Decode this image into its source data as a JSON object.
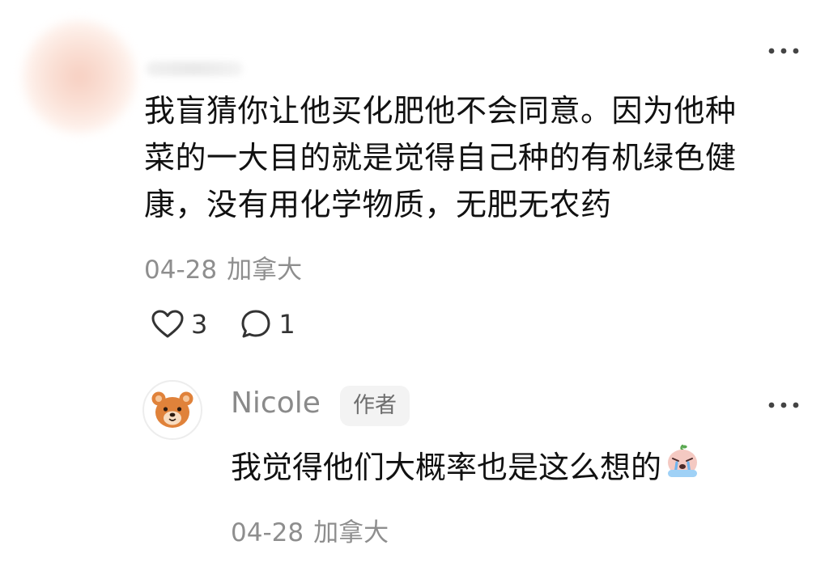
{
  "comment": {
    "body_lines": [
      "我盲猜你让他买化肥他不会同意。因为他种",
      "菜的一大目的就是觉得自己种的有机绿色健",
      "康，没有用化学物质，无肥无农药"
    ],
    "date": "04-28",
    "location": "加拿大",
    "like_count": "3",
    "reply_count": "1",
    "like_icon": "heart-outline-icon",
    "reply_icon": "chat-bubble-icon",
    "more_icon": "more-dots-icon"
  },
  "reply": {
    "author": "Nicole",
    "badge": "作者",
    "avatar_icon": "bear-face-icon",
    "body": "我觉得他们大概率也是这么想的",
    "emoji_icon": "crying-emoji-icon",
    "date": "04-28",
    "location": "加拿大",
    "more_icon": "more-dots-icon"
  },
  "colors": {
    "text_primary": "#111111",
    "text_meta": "#8e8e8e",
    "badge_bg": "#f3f3f3",
    "bear_fill": "#e0823a"
  }
}
